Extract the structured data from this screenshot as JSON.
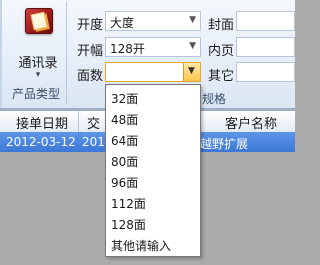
{
  "product_group": {
    "contacts_button": "通讯录",
    "arrow": "▾",
    "group_label": "产品类型"
  },
  "spec_group": {
    "format_label": "开度",
    "format_value": "大度",
    "size_label": "开幅",
    "size_value": "128开",
    "pages_label": "面数",
    "pages_value": "",
    "cover_label": "封面",
    "inner_label": "内页",
    "other_label": "其它",
    "group_label": "规格"
  },
  "grid": {
    "columns": [
      "接单日期",
      "交",
      "客户名称"
    ],
    "row": {
      "date": "2012-03-12",
      "partial": "2012",
      "customer": "越野扩展"
    }
  },
  "pages_dropdown": {
    "options": [
      "32面",
      "48面",
      "64面",
      "80面",
      "96面",
      "112面",
      "128面",
      "其他请输入"
    ]
  },
  "colors": {
    "selection": "#3d78d6",
    "active_combo": "#ffc74a"
  }
}
